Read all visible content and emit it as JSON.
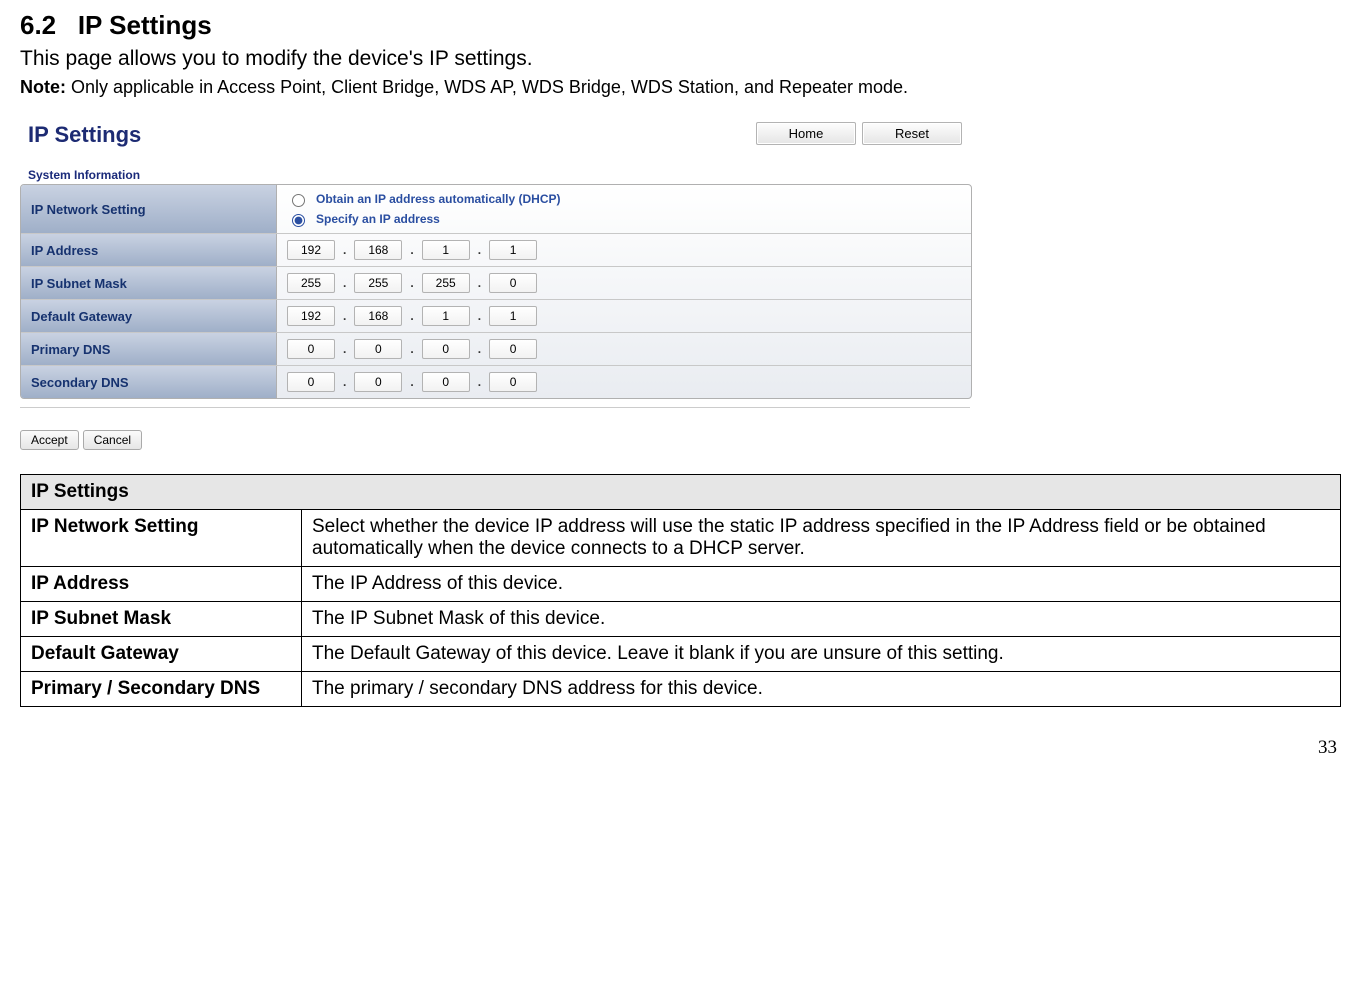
{
  "section": {
    "number": "6.2",
    "title": "IP Settings",
    "intro": "This page allows you to modify the device's IP settings.",
    "note_label": "Note:",
    "note_text": " Only applicable in Access Point, Client Bridge, WDS AP, WDS Bridge, WDS Station, and Repeater mode."
  },
  "shot": {
    "title": "IP Settings",
    "home": "Home",
    "reset": "Reset",
    "sysinfo": "System Information",
    "rows": {
      "ip_network_setting": "IP Network Setting",
      "dhcp_label": "Obtain an IP address automatically (DHCP)",
      "static_label": "Specify an IP address",
      "ip_address": "IP Address",
      "subnet": "IP Subnet Mask",
      "gateway": "Default Gateway",
      "pdns": "Primary DNS",
      "sdns": "Secondary DNS"
    },
    "values": {
      "ip_address": [
        "192",
        "168",
        "1",
        "1"
      ],
      "subnet": [
        "255",
        "255",
        "255",
        "0"
      ],
      "gateway": [
        "192",
        "168",
        "1",
        "1"
      ],
      "pdns": [
        "0",
        "0",
        "0",
        "0"
      ],
      "sdns": [
        "0",
        "0",
        "0",
        "0"
      ]
    },
    "accept": "Accept",
    "cancel": "Cancel"
  },
  "desc": {
    "header": "IP Settings",
    "rows": [
      {
        "k": "IP Network Setting",
        "v": "Select whether the device IP address will use the static IP address specified in the IP Address field or be obtained automatically when the device connects to a DHCP server."
      },
      {
        "k": "IP Address",
        "v": "The IP Address of this device."
      },
      {
        "k": "IP Subnet Mask",
        "v": "The IP Subnet Mask of this device."
      },
      {
        "k": "Default Gateway",
        "v": "The Default Gateway of this device. Leave it blank if you are unsure of this setting."
      },
      {
        "k": "Primary / Secondary DNS",
        "v": "The primary / secondary DNS address for this device."
      }
    ]
  },
  "page_number": "33"
}
